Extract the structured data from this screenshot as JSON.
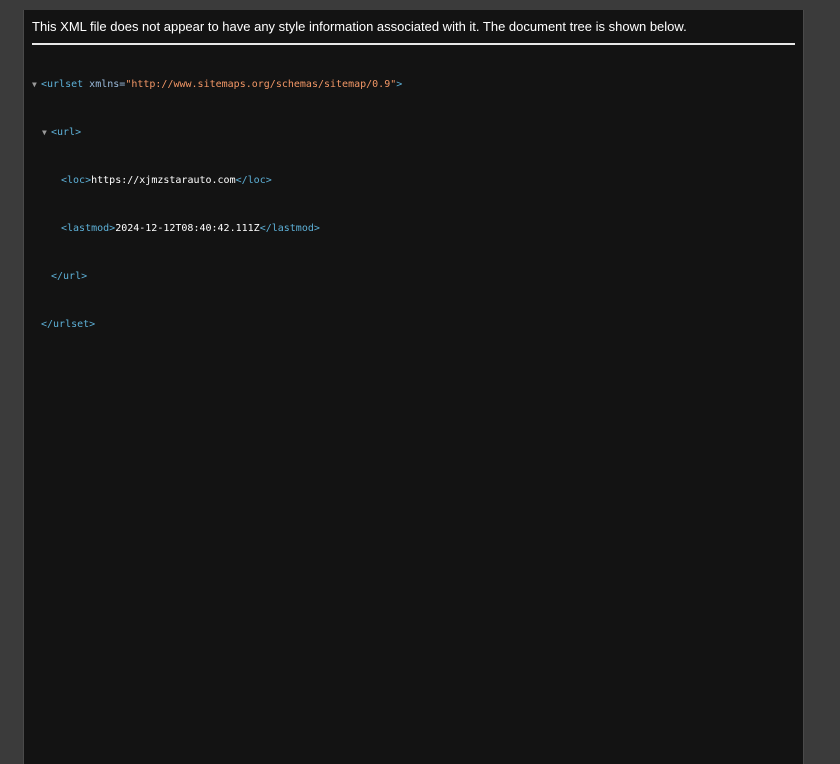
{
  "header": {
    "message": "This XML file does not appear to have any style information associated with it. The document tree is shown below."
  },
  "tree": {
    "urlset_open": "<urlset",
    "xmlns_attr": " xmlns=",
    "xmlns_value": "\"http://www.sitemaps.org/schemas/sitemap/0.9\"",
    "urlset_open_end": ">",
    "url_open": "<url>",
    "loc_open": "<loc>",
    "loc_value": "https://xjmzstarauto.com",
    "loc_close": "</loc>",
    "lastmod_open": "<lastmod>",
    "lastmod_value": "2024-12-12T08:40:42.111Z",
    "lastmod_close": "</lastmod>",
    "url_close": "</url>",
    "urlset_close": "</urlset>",
    "toggle_glyph": "▼"
  },
  "colors": {
    "tag": "#5db0d7",
    "attr_value": "#f29766",
    "text": "#ffffff",
    "background": "#131313"
  }
}
